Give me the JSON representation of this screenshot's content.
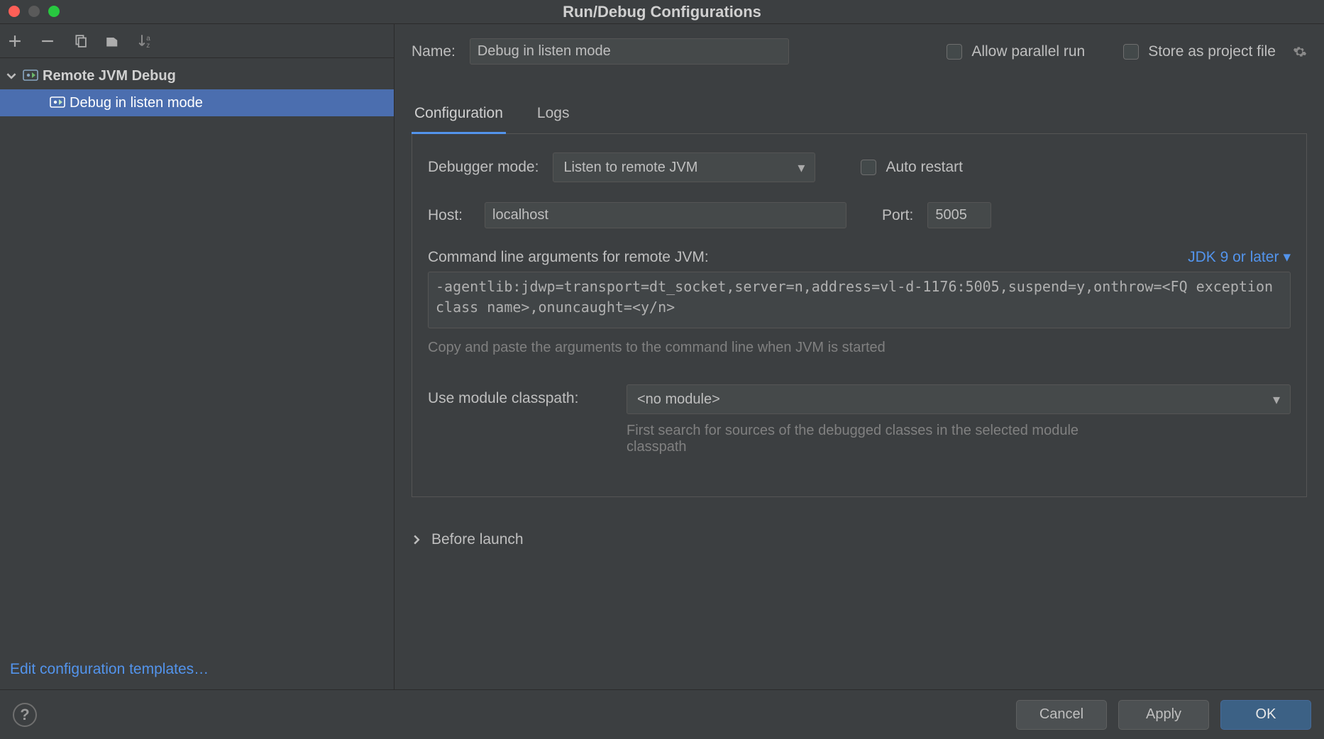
{
  "window": {
    "title": "Run/Debug Configurations"
  },
  "sidebar": {
    "group": {
      "label": "Remote JVM Debug"
    },
    "items": [
      {
        "label": "Debug in listen mode",
        "selected": true
      }
    ],
    "templates_link": "Edit configuration templates…"
  },
  "form": {
    "name_label": "Name:",
    "name_value": "Debug in listen mode",
    "allow_parallel_label": "Allow parallel run",
    "store_project_label": "Store as project file"
  },
  "tabs": {
    "configuration": "Configuration",
    "logs": "Logs"
  },
  "config": {
    "debugger_mode_label": "Debugger mode:",
    "debugger_mode_value": "Listen to remote JVM",
    "auto_restart_label": "Auto restart",
    "host_label": "Host:",
    "host_value": "localhost",
    "port_label": "Port:",
    "port_value": "5005",
    "cmd_label": "Command line arguments for remote JVM:",
    "jdk_label": "JDK 9 or later",
    "cmd_value": "-agentlib:jdwp=transport=dt_socket,server=n,address=vl-d-1176:5005,suspend=y,onthrow=<FQ exception class name>,onuncaught=<y/n>",
    "cmd_hint": "Copy and paste the arguments to the command line when JVM is started",
    "module_label": "Use module classpath:",
    "module_value": "<no module>",
    "module_hint": "First search for sources of the debugged classes in the selected module classpath"
  },
  "before_launch_label": "Before launch",
  "footer": {
    "cancel": "Cancel",
    "apply": "Apply",
    "ok": "OK"
  }
}
